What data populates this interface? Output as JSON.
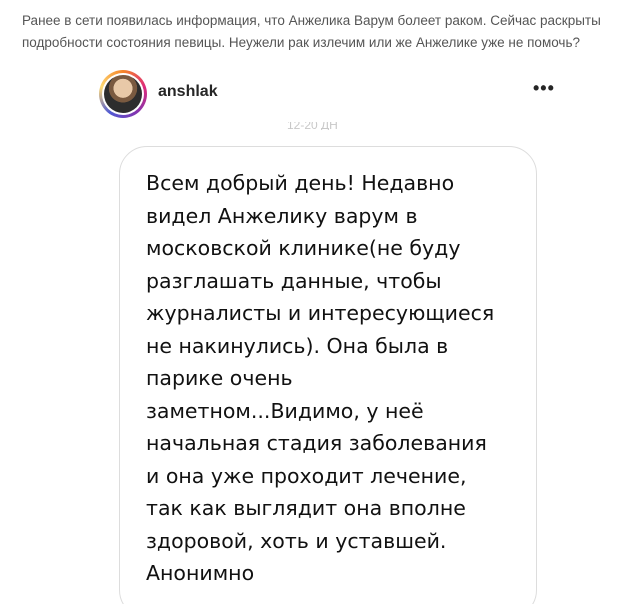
{
  "article": {
    "intro_text": "Ранее в сети появилась информация, что Анжелика Варум болеет раком. Сейчас раскрыты подробности состояния певицы. Неужели рак излечим или же Анжелике уже не помочь?"
  },
  "post": {
    "username": "anshlak",
    "more_label": "•••",
    "partial_caption": "12-20 ДН",
    "message": "Всем добрый день! Недавно\nвидел Анжелику варум в\nмосковской клинике(не буду\nразглашать данные, чтобы\nжурналисты и интересующиеся\nне накинулись). Она была в\nпарике очень\nзаметном...Видимо, у неё\nначальная стадия заболевания\nи она уже проходит лечение,\nтак как выглядит она вполне\nздоровой, хоть и уставшей.\nАнонимно",
    "colors": {
      "avatar_ring": [
        "#f58529",
        "#dd2a7b",
        "#8134af",
        "#515bd4",
        "#feda75"
      ]
    },
    "icons": {
      "more": "ellipsis-icon"
    }
  }
}
